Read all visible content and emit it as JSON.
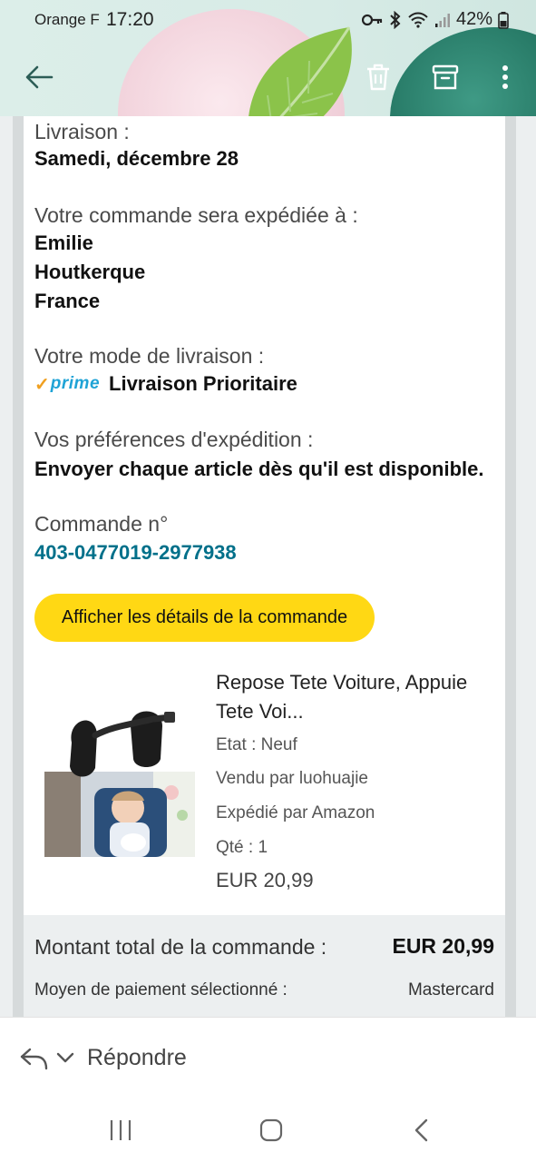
{
  "status_bar": {
    "carrier": "Orange F",
    "time": "17:20",
    "battery": "42%",
    "icons": [
      "key-icon",
      "bluetooth-icon",
      "wifi-icon",
      "signal-icon",
      "battery-icon"
    ]
  },
  "app_bar": {
    "icons": [
      "back-arrow-icon",
      "trash-icon",
      "archive-icon",
      "more-vert-icon"
    ]
  },
  "email": {
    "delivery_label": "Livraison :",
    "delivery_date": "Samedi, décembre 28",
    "ship_to_label": "Votre commande sera expédiée à :",
    "ship_to_lines": [
      "Emilie",
      "Houtkerque",
      "France"
    ],
    "shipping_mode_label": "Votre mode de livraison :",
    "prime_logo_text": "prime",
    "shipping_mode_value": "Livraison Prioritaire",
    "preferences_label": "Vos préférences d'expédition :",
    "preferences_value": "Envoyer chaque article dès qu'il est disponible.",
    "order_number_label": "Commande n°",
    "order_number": "403-0477019-2977938",
    "details_button": "Afficher les détails de la commande",
    "product": {
      "title": "Repose Tete Voiture, Appuie Tete Voi...",
      "state": "Etat : Neuf",
      "seller": "Vendu par luohuajie",
      "shipped_by": "Expédié par Amazon",
      "quantity": "Qté : 1",
      "price": "EUR 20,99"
    },
    "total_label": "Montant total de la commande :",
    "total_value": "EUR 20,99",
    "payment_label": "Moyen de paiement sélectionné :",
    "payment_value": "Mastercard"
  },
  "reply_bar": {
    "label": "Répondre"
  },
  "nav_bar": {
    "icons": [
      "recent-apps-icon",
      "home-icon",
      "nav-back-icon"
    ]
  },
  "colors": {
    "accent_link": "#00708a",
    "button_yellow": "#ffd814",
    "prime_blue": "#1fa3d6",
    "prime_orange": "#f0a020"
  }
}
